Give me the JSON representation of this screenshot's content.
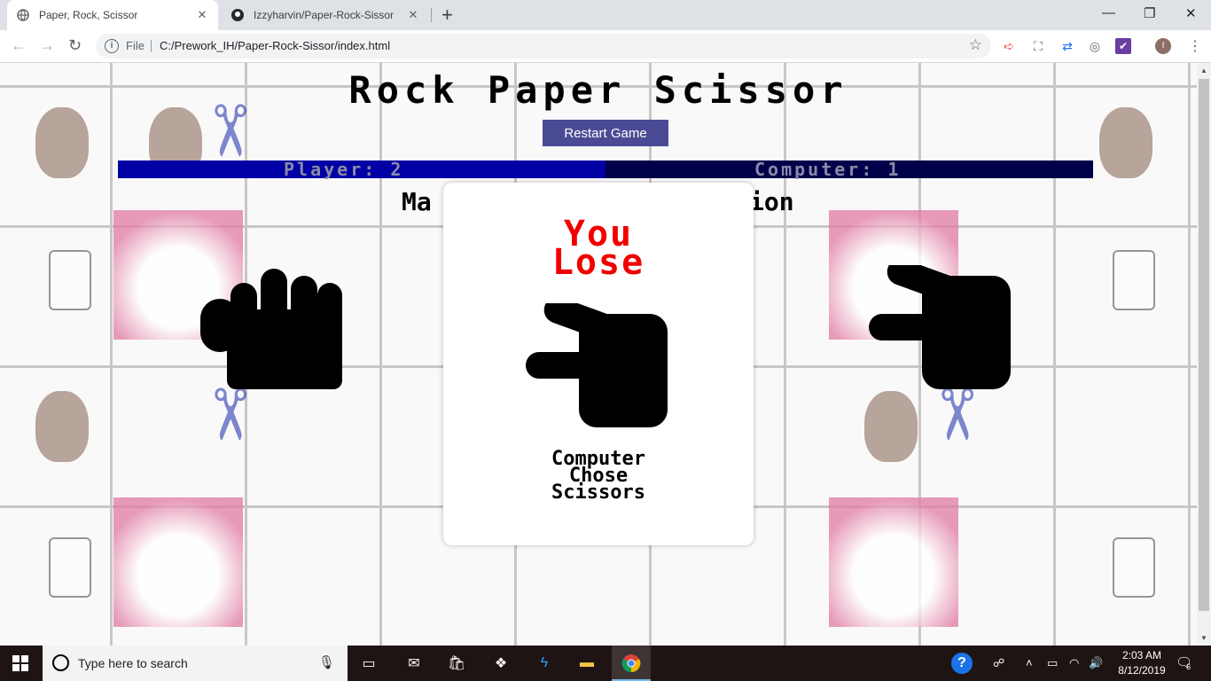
{
  "browser": {
    "tabs": [
      {
        "title": "Paper, Rock, Scissor",
        "active": true
      },
      {
        "title": "Izzyharvin/Paper-Rock-Sissor",
        "active": false
      }
    ],
    "new_tab_label": "+",
    "window_controls": {
      "minimize": "—",
      "restore": "❐",
      "close": "✕"
    },
    "nav": {
      "back": "←",
      "forward": "→",
      "reload": "↻"
    },
    "omnibox": {
      "scheme_label": "File",
      "url": "C:/Prework_IH/Paper-Rock-Sissor/index.html"
    },
    "avatar_initial": "I"
  },
  "page": {
    "title": "Rock Paper Scissor",
    "restart_label": "Restart Game",
    "player_score": "Player: 2",
    "computer_score": "Computer: 1",
    "match_left": "Ma",
    "match_right": "ion"
  },
  "modal": {
    "result_line1": "You",
    "result_line2": "Lose",
    "chose_line1": "Computer",
    "chose_line2": "Chose",
    "chose_line3": "Scissors",
    "result_color": "#f20000"
  },
  "taskbar": {
    "search_placeholder": "Type here to search",
    "time": "2:03 AM",
    "date": "8/12/2019",
    "notification_count": "6"
  },
  "colors": {
    "restart_button": "#4b4b95",
    "player_bar": "#0000a4",
    "computer_bar": "#00004a"
  }
}
